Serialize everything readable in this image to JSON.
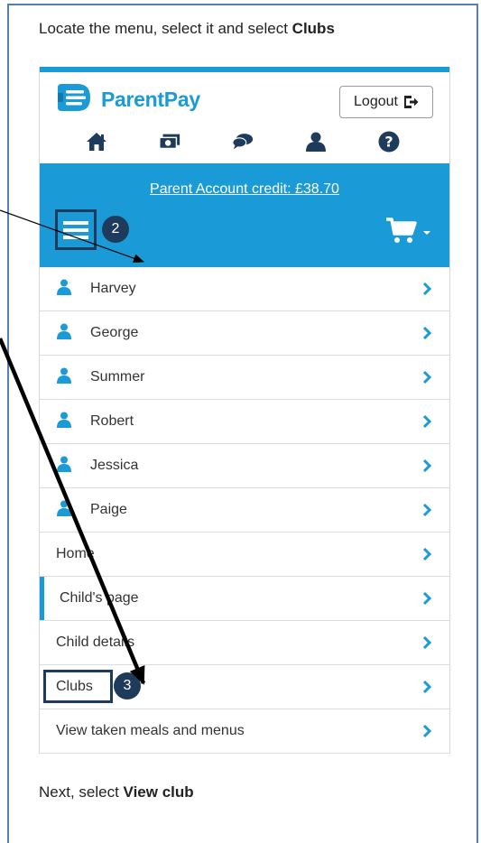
{
  "instructions": {
    "top_prefix": "Locate the menu, select it and select ",
    "top_bold": "Clubs",
    "bottom_prefix": "Next, select ",
    "bottom_bold": "View club"
  },
  "app": {
    "logo_text": "ParentPay",
    "logout_label": "Logout",
    "nav_icons": [
      "home-icon",
      "payments-icon",
      "messages-icon",
      "account-icon",
      "help-icon"
    ],
    "credit_text": "Parent Account credit: £38.70",
    "accent_color": "#1a9ad6",
    "highlight_color": "#1f3b5c"
  },
  "callouts": {
    "menu_badge": "2",
    "clubs_badge": "3"
  },
  "menu": {
    "children": [
      "Harvey",
      "George",
      "Summer",
      "Robert",
      "Jessica",
      "Paige"
    ],
    "links": [
      "Home",
      "Child's page",
      "Child details",
      "Clubs",
      "View taken meals and menus"
    ]
  }
}
